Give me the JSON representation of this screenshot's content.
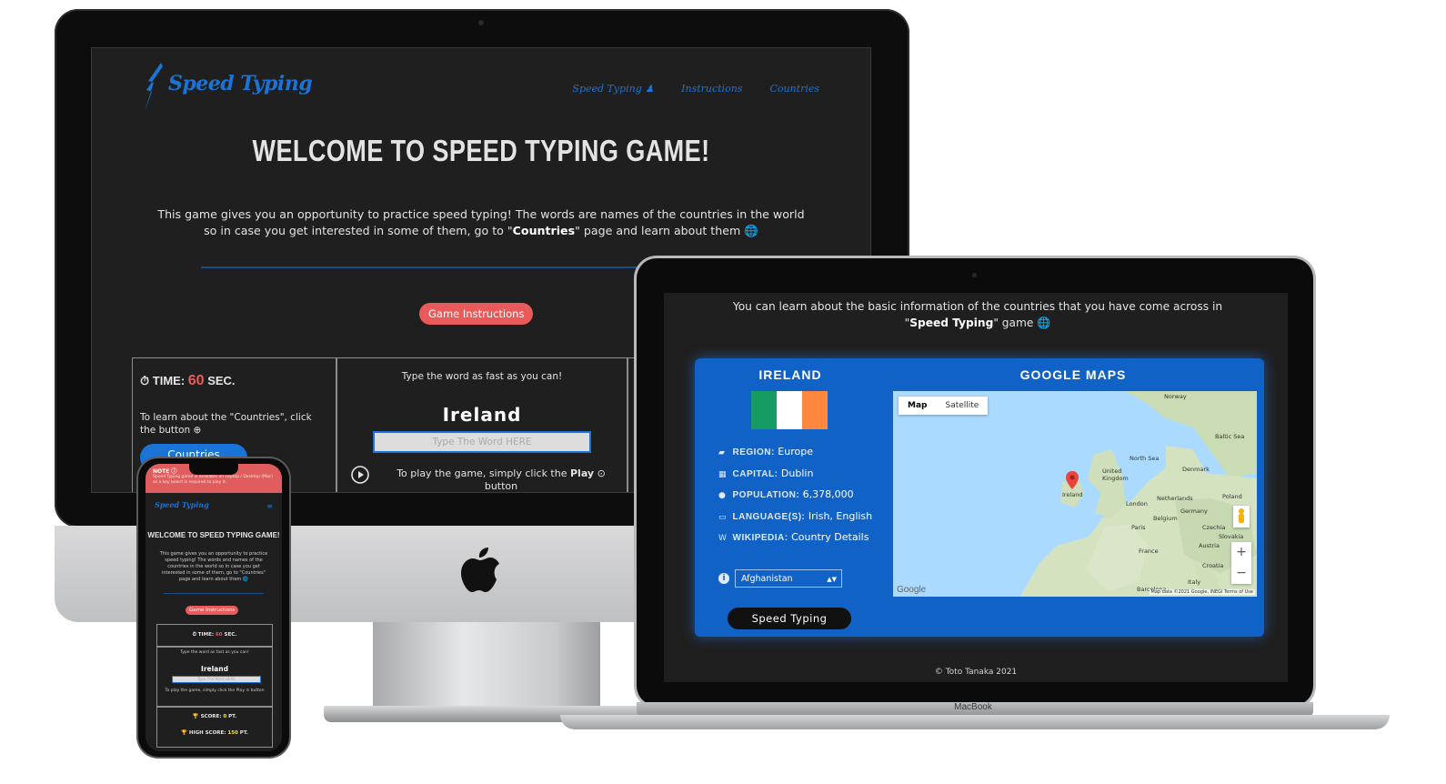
{
  "desktop": {
    "logo": "Speed Typing",
    "nav": [
      "Speed Typing ♟",
      "Instructions",
      "Countries"
    ],
    "title": "WELCOME TO SPEED TYPING GAME!",
    "intro_pre": "This game gives you an opportunity to practice speed typing! The words are names of the countries in the world so in case you get interested in some of them, go to \"",
    "intro_bold": "Countries",
    "intro_post": "\" page and learn about them 🌐",
    "instructions_button": "Game Instructions",
    "time_label": "TIME:",
    "time_value": "60",
    "time_unit": "SEC.",
    "learn_text": "To learn about the \"Countries\", click the button ⊕",
    "countries_button": "Countries",
    "type_hint": "Type the word as fast as you can!",
    "current_word": "Ireland",
    "input_placeholder": "Type The Word HERE",
    "play_text_pre": "To play the game, simply click the ",
    "play_text_bold": "Play",
    "play_text_post": " ⊙ button"
  },
  "phone": {
    "note_title": "NOTE ⓘ",
    "note_text": "Speed Typing game is available on Laptop / Desktop (Mac) as a key board is required to play it.",
    "logo": "Speed Typing",
    "menu_icon": "≡",
    "title": "WELCOME TO SPEED TYPING GAME!",
    "intro": "This game gives you an opportunity to practice speed typing! The words and names of the countries in the world so in case you get interested in some of them, go to \"Countries\" page and learn about them 🌐",
    "instructions_button": "Game Instructions",
    "time_label": "⏱ TIME:",
    "time_value": "60",
    "time_unit": "SEC.",
    "type_hint": "Type the word as fast as you can!",
    "current_word": "Ireland",
    "input_placeholder": "Type The Word HERE",
    "play_text": "To play the game, simply click the Play ⊙ button",
    "score_label": "🏆 SCORE:",
    "score_value": "0",
    "score_unit": "PT.",
    "high_label": "🏆 HIGH SCORE:",
    "high_value": "150",
    "high_unit": "PT."
  },
  "laptop": {
    "intro_pre": "You can learn about the basic information of the countries that you have come across in \"",
    "intro_bold": "Speed Typing",
    "intro_post": "\" game 🌐",
    "country_name": "IRELAND",
    "flag_colors": [
      "#169b62",
      "#ffffff",
      "#ff883e"
    ],
    "region_label": "REGION:",
    "region_value": "Europe",
    "capital_label": "CAPITAL:",
    "capital_value": "Dublin",
    "population_label": "POPULATION:",
    "population_value": "6,378,000",
    "language_label": "LANGUAGE(S):",
    "language_value": "Irish, English",
    "wikipedia_label": "WIKIPEDIA:",
    "wikipedia_value": "Country Details",
    "select_value": "Afghanistan",
    "speed_typing_button": "Speed Typing",
    "maps_title": "GOOGLE MAPS",
    "map_tab_map": "Map",
    "map_tab_satellite": "Satellite",
    "map_labels": [
      "Norway",
      "Baltic Sea",
      "North Sea",
      "Denmark",
      "United Kingdom",
      "Ireland",
      "London",
      "Netherlands",
      "Poland",
      "Belgium",
      "Germany",
      "Paris",
      "Czechia",
      "Slovakia",
      "Austria",
      "France",
      "Croatia",
      "Italy",
      "Barcelona"
    ],
    "zoom_in": "+",
    "zoom_out": "−",
    "google_mark": "Google",
    "map_attribution": "Map data ©2021 Google, INEGI   Terms of Use",
    "footer": "© Toto Tanaka 2021",
    "brand": "MacBook"
  },
  "colors": {
    "accent_blue": "#1a73d6",
    "accent_red": "#e95b5b",
    "background_dark": "#1f1f1f",
    "card_blue": "#1162c7"
  }
}
